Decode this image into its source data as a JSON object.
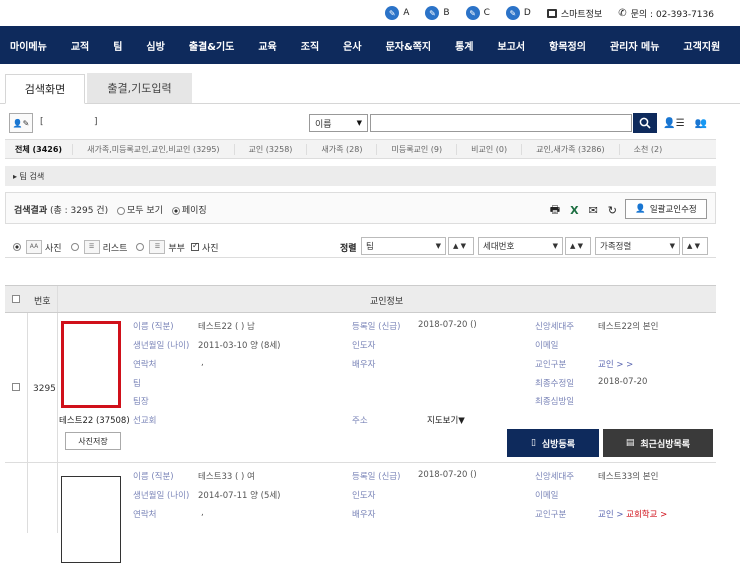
{
  "topbar": {
    "items": [
      {
        "label": "A",
        "icon": "wrench-icon"
      },
      {
        "label": "B",
        "icon": "wrench-icon"
      },
      {
        "label": "C",
        "icon": "wrench-icon"
      },
      {
        "label": "D",
        "icon": "wrench-icon"
      }
    ],
    "smartphone": "스마트정보",
    "contact": "문의 : 02-393-7136"
  },
  "nav": [
    "마이메뉴",
    "교적",
    "팀",
    "심방",
    "출결&기도",
    "교육",
    "조직",
    "은사",
    "문자&쪽지",
    "통계",
    "보고서",
    "항목정의",
    "관리자 메뉴",
    "고객지원"
  ],
  "tabs": {
    "active": "검색화면",
    "inactive": "출결,기도입력"
  },
  "search": {
    "bracket_open": "[",
    "bracket_close": "]",
    "field_select": "이름",
    "input_value": "",
    "input_placeholder": ""
  },
  "categories": [
    {
      "label": "전체 (3426)",
      "active": true
    },
    {
      "label": "새가족,미등록교인,교인,비교인 (3295)",
      "active": false
    },
    {
      "label": "교인 (3258)",
      "active": false
    },
    {
      "label": "새가족 (28)",
      "active": false
    },
    {
      "label": "미등록교인 (9)",
      "active": false
    },
    {
      "label": "비교인 (0)",
      "active": false
    },
    {
      "label": "교인,새가족 (3286)",
      "active": false
    },
    {
      "label": "소천 (2)",
      "active": false
    }
  ],
  "detail_search": "▸  팀 검색",
  "results": {
    "label": "검색결과",
    "count": "(총 : 3295 건)",
    "opt_all": "모두 보기",
    "opt_page": "페이징",
    "bulk_btn": "일괄교인수정"
  },
  "view": {
    "photo": "사진",
    "list": "리스트",
    "couple": "부부",
    "photo_chk": "사진",
    "sort_label": "정렬",
    "sort1": "팀",
    "sort2": "세대번호",
    "sort3": "가족정렬",
    "updown": "▲ ▼"
  },
  "table": {
    "col_no": "번호",
    "col_info": "교인정보"
  },
  "labels": {
    "name": "이름 (직분)",
    "birth": "생년월일 (나이)",
    "contact": "연락처",
    "team": "팀",
    "teamlead": "팀장",
    "regdate": "등록일 (신급)",
    "guide": "인도자",
    "spouse": "배우자",
    "head": "신앙세대주",
    "email": "이메일",
    "type": "교인구분",
    "lastvisit": "최종수정일",
    "lastvisit2": "최종심방일",
    "mission": "선교회",
    "address": "주소",
    "mapview": "지도보기▼",
    "photo_save": "사진저장",
    "visit_reg": "심방등록",
    "recent_visits": "최근심방목록"
  },
  "rows": [
    {
      "no": "3295",
      "name": "테스트22 ( ) 남",
      "birth": "2011-03-10 양 (8세)",
      "contact": ",",
      "regdate": "2018-07-20 ()",
      "head": "테스트22의 본인",
      "type": "교인 > >",
      "lastmod": "2018-07-20",
      "caption": "테스트22 (37508)"
    },
    {
      "name": "테스트33 ( ) 여",
      "birth": "2014-07-11 양 (5세)",
      "contact": ",",
      "regdate": "2018-07-20 ()",
      "head": "테스트33의 본인",
      "type_prefix": "교인 > ",
      "type_red": "교회학교 >"
    }
  ],
  "colors": {
    "nav_bg": "#0e2a5c",
    "accent": "#2b73c8",
    "highlight": "#d0101a"
  }
}
